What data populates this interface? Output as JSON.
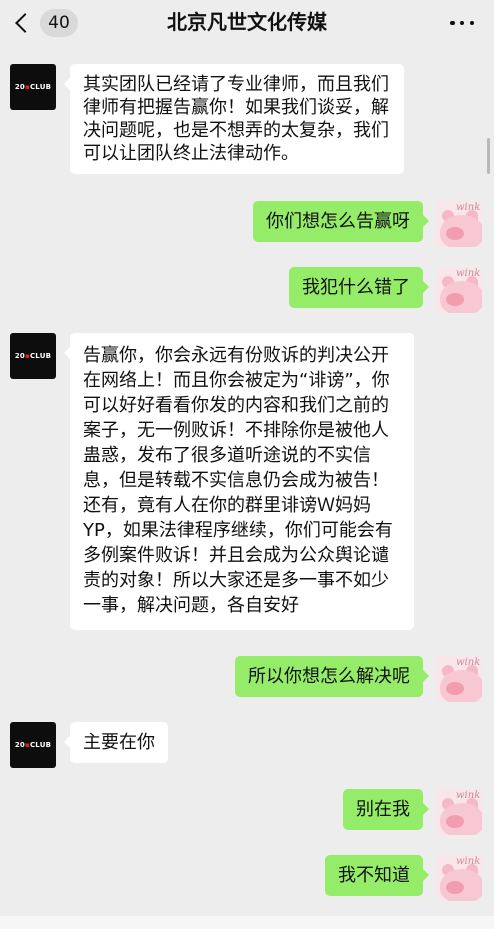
{
  "header": {
    "unread_count": "40",
    "title": "北京凡世文化传媒"
  },
  "avatars": {
    "left_logo_prefix": "20",
    "left_logo_mark": "▪",
    "left_logo_suffix": "CLUB",
    "right_sticker_text": "wink"
  },
  "messages": [
    {
      "side": "left",
      "text": "其实团队已经请了专业律师，而且我们律师有把握告赢你！如果我们谈妥，解决问题呢，也是不想弄的太复杂，我们可以让团队终止法律动作。"
    },
    {
      "side": "right",
      "text": "你们想怎么告赢呀"
    },
    {
      "side": "right",
      "text": "我犯什么错了"
    },
    {
      "side": "left",
      "text": "告赢你，你会永远有份败诉的判决公开在网络上！而且你会被定为“诽谤”，你可以好好看看你发的内容和我们之前的案子，无一例败诉！不排除你是被他人蛊惑，发布了很多道听途说的不实信息，但是转载不实信息仍会成为被告！还有，竟有人在你的群里诽谤Ｗ妈妈YP，如果法律程序继续，你们可能会有多例案件败诉！并且会成为公众舆论谴责的对象！所以大家还是多一事不如少一事，解决问题，各自安好"
    },
    {
      "side": "right",
      "text": "所以你想怎么解决呢"
    },
    {
      "side": "left",
      "text": "主要在你"
    },
    {
      "side": "right",
      "text": "别在我"
    },
    {
      "side": "right",
      "text": "我不知道"
    }
  ],
  "colors": {
    "background": "#ededed",
    "bubble_left": "#ffffff",
    "bubble_right": "#95ec69"
  }
}
